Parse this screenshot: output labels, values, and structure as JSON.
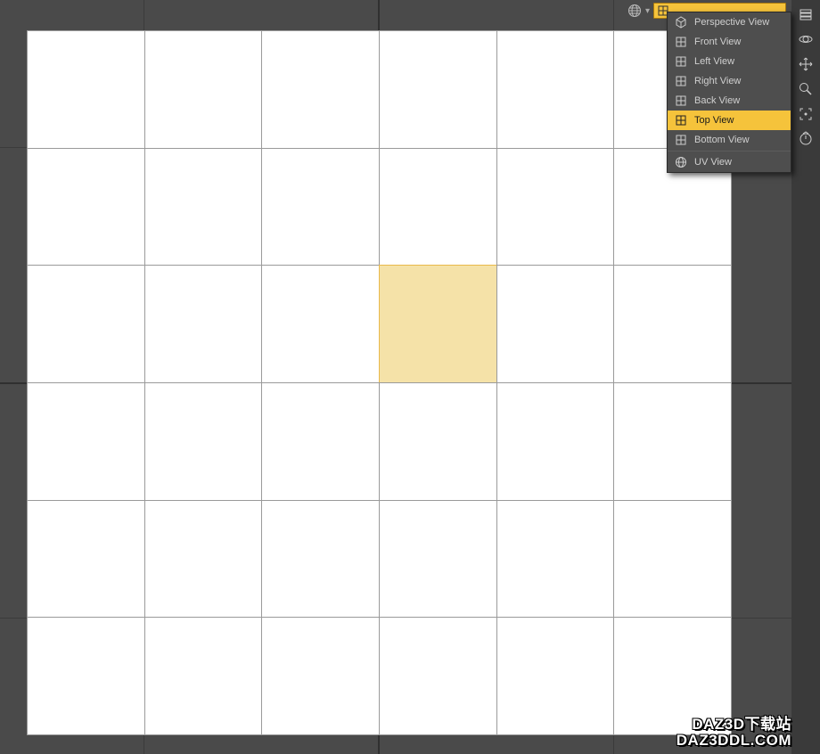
{
  "viewport": {
    "grid_cols": 6,
    "grid_rows": 6,
    "selected_cell": {
      "row": 2,
      "col": 3
    }
  },
  "view_trigger": {
    "active_view": "Top View"
  },
  "view_menu": {
    "items": [
      {
        "label": "Perspective View",
        "icon": "cube-icon"
      },
      {
        "label": "Front View",
        "icon": "grid-icon"
      },
      {
        "label": "Left View",
        "icon": "grid-icon"
      },
      {
        "label": "Right View",
        "icon": "grid-icon"
      },
      {
        "label": "Back View",
        "icon": "grid-icon"
      },
      {
        "label": "Top View",
        "icon": "grid-icon",
        "highlight": true
      },
      {
        "label": "Bottom View",
        "icon": "grid-icon"
      }
    ],
    "items_after_sep": [
      {
        "label": "UV View",
        "icon": "globe-icon"
      }
    ]
  },
  "tool_strip": {
    "buttons": [
      {
        "name": "layers-icon"
      },
      {
        "name": "orbit-icon"
      },
      {
        "name": "pan-icon"
      },
      {
        "name": "zoom-icon"
      },
      {
        "name": "frame-icon"
      },
      {
        "name": "reset-icon"
      }
    ]
  },
  "watermark": {
    "line1": "DAZ3D下载站",
    "line2": "DAZ3DDL.COM"
  }
}
